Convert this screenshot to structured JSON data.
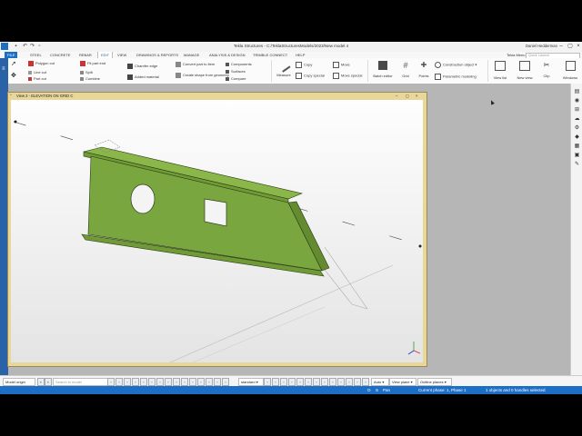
{
  "app": {
    "title": "Tekla Structures - C:/TeklaStructuresModels/2023/New model 4",
    "user": "Daniel Hedderman"
  },
  "menu": [
    "FILE",
    "STEEL",
    "CONCRETE",
    "REBAR",
    "EDIT",
    "VIEW",
    "DRAWINGS & REPORTS",
    "MANAGE",
    "ANALYSIS & DESIGN",
    "TRIMBLE CONNECT",
    "HELP"
  ],
  "menu_active": "EDIT",
  "search": {
    "menu_label": "Tekla Menu",
    "quick_launch": "Quick Launch"
  },
  "ribbon": {
    "polygon_cut": "Polygon cut",
    "line_cut": "Line cut",
    "part_cut": "Part cut",
    "fit_part_end": "Fit part end",
    "split": "Split",
    "combine": "Combine",
    "chamfer_edge": "Chamfer edge",
    "added_material": "Added material",
    "convert_part_to_item": "Convert part to item",
    "create_shape_from_geometry": "Create shape from geometry",
    "components": "Components",
    "surfaces": "Surfaces",
    "compare": "Compare",
    "measure": "Measure",
    "copy": "Copy",
    "copy_special": "Copy special",
    "move": "Move",
    "move_special": "Move special",
    "batch_editor": "Batch editor",
    "grid": "Grid",
    "points": "Points",
    "construction_object": "Construction object",
    "parametric_modeling": "Parametric modeling",
    "view_list": "View list",
    "new_view": "New view",
    "clip_plane": "Clip",
    "windows": "Windows"
  },
  "view_window": {
    "title": "View 2 - ELEVATION ON GRID C"
  },
  "status": {
    "model_origin": "Model origin",
    "search_placeholder": "Search in model",
    "standard": "standard",
    "auto": "Auto",
    "view_plane": "View plane",
    "outline_planes": "Outline planes"
  },
  "bottom": {
    "mode": "O",
    "pan": "S",
    "pan_label": "Pan",
    "phase": "Current phase: 1, Phase 1",
    "selection": "1 objects and 0 handles selected"
  },
  "colors": {
    "steel_green": "#7aa640",
    "accent_blue": "#1d6fc5",
    "view_frame": "#e8d79a"
  }
}
